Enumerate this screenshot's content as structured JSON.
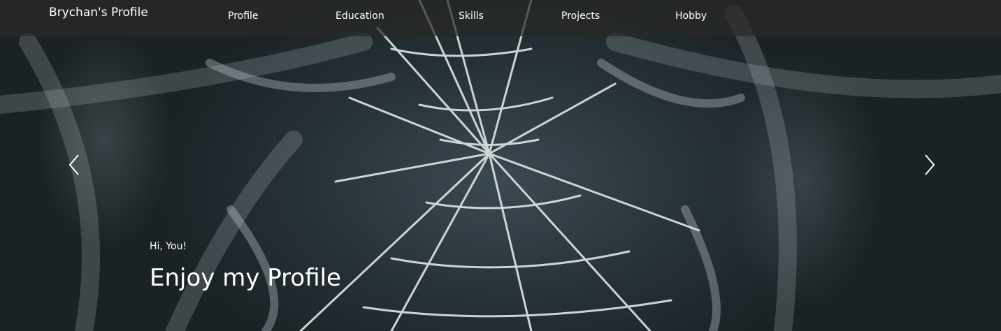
{
  "navbar": {
    "brand": "Brychan's Profile",
    "links": [
      {
        "label": "Profile"
      },
      {
        "label": "Education"
      },
      {
        "label": "Skills"
      },
      {
        "label": "Projects"
      },
      {
        "label": "Hobby"
      }
    ]
  },
  "carousel": {
    "prev_icon": "chevron-left-icon",
    "next_icon": "chevron-right-icon",
    "caption": {
      "subtitle": "Hi, You!",
      "title": "Enjoy my Profile"
    }
  },
  "colors": {
    "navbar_bg": "#282828",
    "text": "#ffffff",
    "web_strand": "#dfe5e7"
  }
}
